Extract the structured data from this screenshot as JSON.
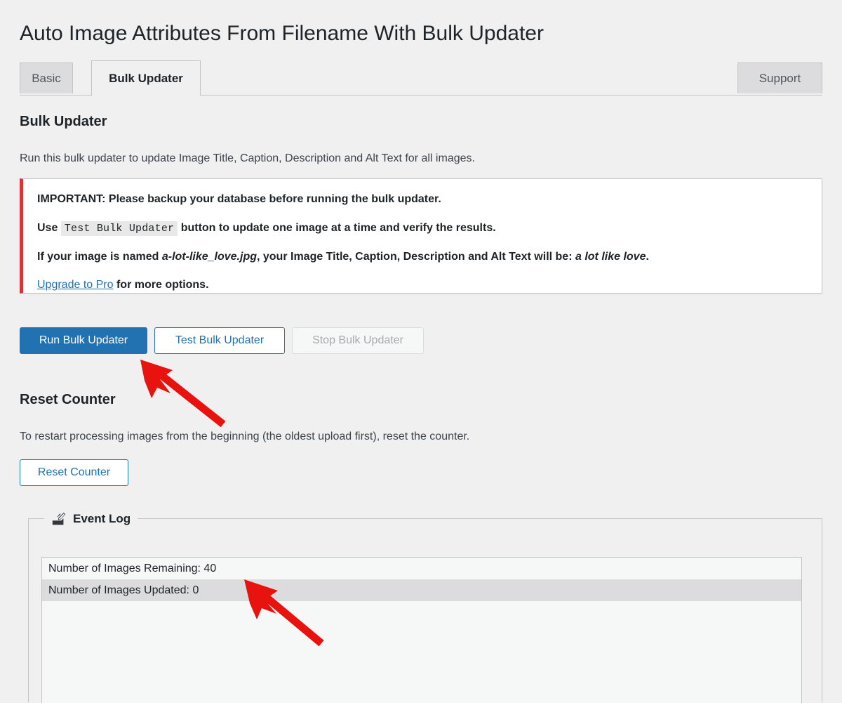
{
  "page": {
    "title": "Auto Image Attributes From Filename With Bulk Updater",
    "background_color": "#f0f0f1"
  },
  "tabs": [
    {
      "label": "Basic",
      "active": false
    },
    {
      "label": "Bulk Updater",
      "active": true
    },
    {
      "label": "Support",
      "active": false
    }
  ],
  "bulk_updater": {
    "heading": "Bulk Updater",
    "description": "Run this bulk updater to update Image Title, Caption, Description and Alt Text for all images.",
    "notice": {
      "accent_color": "#d63638",
      "line1": "IMPORTANT: Please backup your database before running the bulk updater.",
      "line2_prefix": "Use",
      "line2_code": "Test Bulk Updater",
      "line2_suffix": "button to update one image at a time and verify the results.",
      "line3_prefix": "If your image is named",
      "line3_filename": "a-lot-like_love.jpg",
      "line3_middle": ", your Image Title, Caption, Description and Alt Text will be:",
      "line3_result": "a lot like love",
      "line3_period": ".",
      "line4_link": "Upgrade to Pro",
      "line4_suffix": "for more options."
    },
    "buttons": {
      "run": "Run Bulk Updater",
      "test": "Test Bulk Updater",
      "stop": "Stop Bulk Updater"
    },
    "primary_color": "#2271b1"
  },
  "reset_counter": {
    "heading": "Reset Counter",
    "description": "To restart processing images from the beginning (the oldest upload first), reset the counter.",
    "button": "Reset Counter"
  },
  "event_log": {
    "legend": "Event Log",
    "icon": "edit-compose-icon",
    "rows": [
      "Number of Images Remaining: 40",
      "Number of Images Updated: 0"
    ]
  },
  "annotations": {
    "arrow_color": "#e8120e",
    "arrows": [
      {
        "name": "arrow-to-run-button",
        "points_to": "Run Bulk Updater"
      },
      {
        "name": "arrow-to-images-remaining",
        "points_to": "Number of Images Remaining: 40"
      }
    ]
  }
}
